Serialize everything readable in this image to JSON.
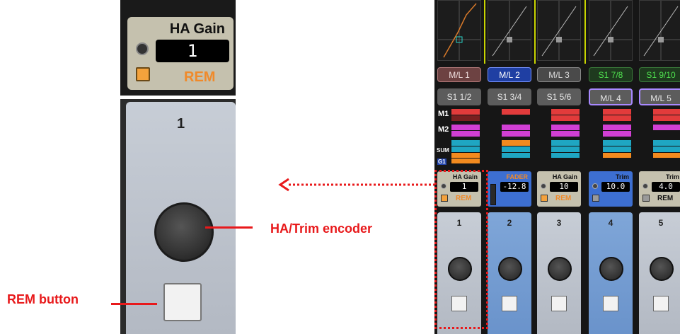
{
  "zoom": {
    "param_title": "HA Gain",
    "param_value": "1",
    "rem_label": "REM",
    "channel_number": "1"
  },
  "annotations": {
    "encoder_label": "HA/Trim encoder",
    "rem_button_label": "REM button"
  },
  "console": {
    "ml_buttons": [
      "M/L 1",
      "M/L 2",
      "M/L 3",
      "S1 7/8",
      "S1 9/10"
    ],
    "s1_buttons": [
      "S1 1/2",
      "S1 3/4",
      "S1 5/6",
      "M/L 4",
      "M/L 5"
    ],
    "rows": {
      "m1": "M1",
      "m2": "M2",
      "sum": "SUM",
      "g1": "G1"
    },
    "params": [
      {
        "title": "HA Gain",
        "value": "1",
        "rem": "REM"
      },
      {
        "title": "FADER",
        "value": "-12.8",
        "rem": ""
      },
      {
        "title": "HA Gain",
        "value": "10",
        "rem": "REM"
      },
      {
        "title": "Trim",
        "value": "10.0",
        "rem": ""
      },
      {
        "title": "Trim",
        "value": "4.0",
        "rem": "REM"
      }
    ],
    "strip_numbers": [
      "1",
      "2",
      "3",
      "4",
      "5"
    ]
  },
  "colors": {
    "accent_red": "#e8191b",
    "rem_orange": "#f08a2a",
    "fader_blue": "#3d6fd1"
  }
}
